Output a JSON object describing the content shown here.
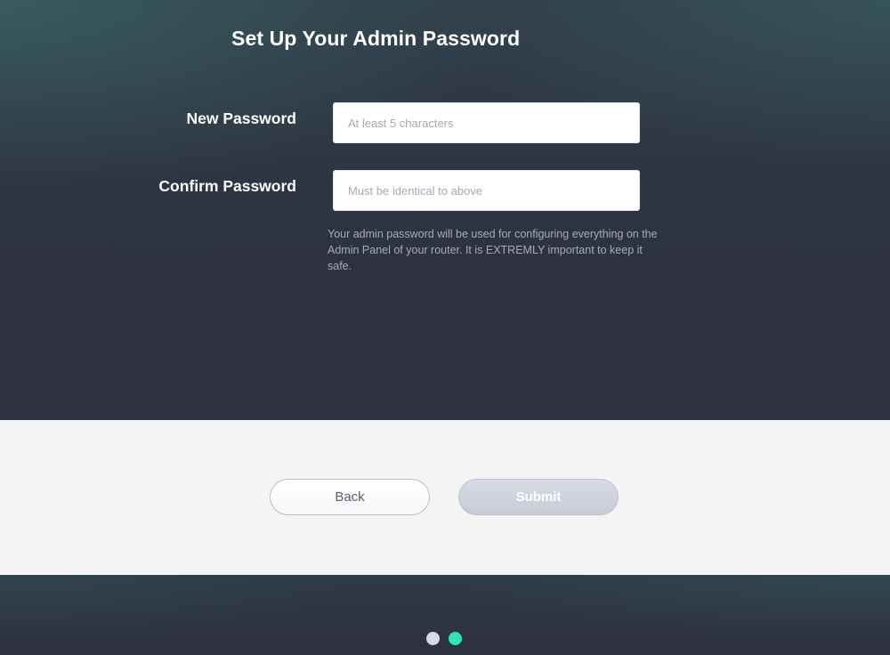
{
  "header": {
    "title": "Set Up Your Admin Password"
  },
  "form": {
    "new_password": {
      "label": "New Password",
      "placeholder": "At least 5 characters",
      "value": ""
    },
    "confirm_password": {
      "label": "Confirm Password",
      "placeholder": "Must be identical to above",
      "value": ""
    },
    "help_text": "Your admin password will be used for configuring everything on the Admin Panel of your router. It is EXTREMLY important to keep it safe."
  },
  "buttons": {
    "back_label": "Back",
    "submit_label": "Submit"
  },
  "pagination": {
    "steps": [
      {
        "state": "inactive",
        "color": "#d6dbe3"
      },
      {
        "state": "active",
        "color": "#2ee6b4"
      }
    ]
  },
  "colors": {
    "accent": "#2ee6b4",
    "background_dark": "#2e3341",
    "background_light": "#f4f4f4",
    "submit_disabled": "#cdd2da"
  }
}
